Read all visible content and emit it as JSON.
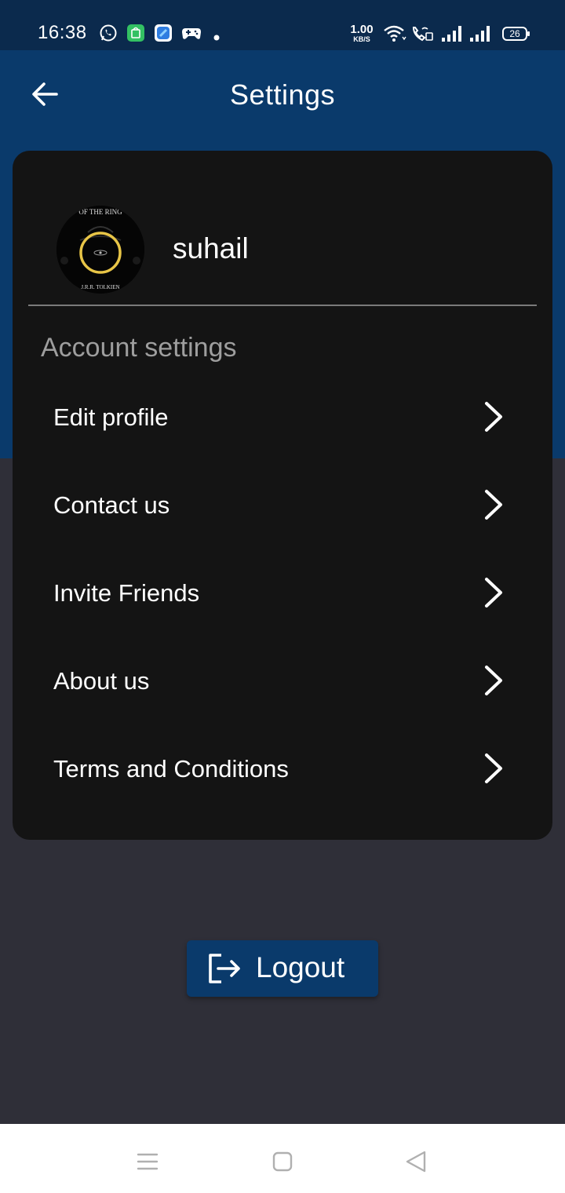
{
  "status_bar": {
    "time": "16:38",
    "net_speed_value": "1.00",
    "net_speed_unit": "KB/S",
    "battery": "26",
    "icons": [
      "whatsapp-icon",
      "app-store-icon",
      "app-icon",
      "game-controller-icon",
      "dot-icon",
      "wifi-icon",
      "wifi-call-icon",
      "signal-icon",
      "signal-icon",
      "battery-icon"
    ]
  },
  "header": {
    "title": "Settings",
    "back_icon": "arrow-left-icon"
  },
  "profile": {
    "username": "suhail",
    "avatar_text_top": "OF THE RING",
    "avatar_text_bottom": "J.R.R. TOLKIEN"
  },
  "account": {
    "section_title": "Account settings",
    "items": [
      {
        "label": "Edit profile"
      },
      {
        "label": "Contact us"
      },
      {
        "label": "Invite Friends"
      },
      {
        "label": "About us"
      },
      {
        "label": "Terms and Conditions"
      }
    ]
  },
  "logout": {
    "label": "Logout",
    "icon": "logout-icon"
  },
  "nav_bar": {
    "buttons": [
      "menu-icon",
      "home-square-icon",
      "back-triangle-icon"
    ]
  },
  "colors": {
    "status_bar": "#0b2a4d",
    "app_bar": "#0a3a6b",
    "background": "#2f2f38",
    "card": "#141414",
    "accent_ring": "#e8c547"
  }
}
